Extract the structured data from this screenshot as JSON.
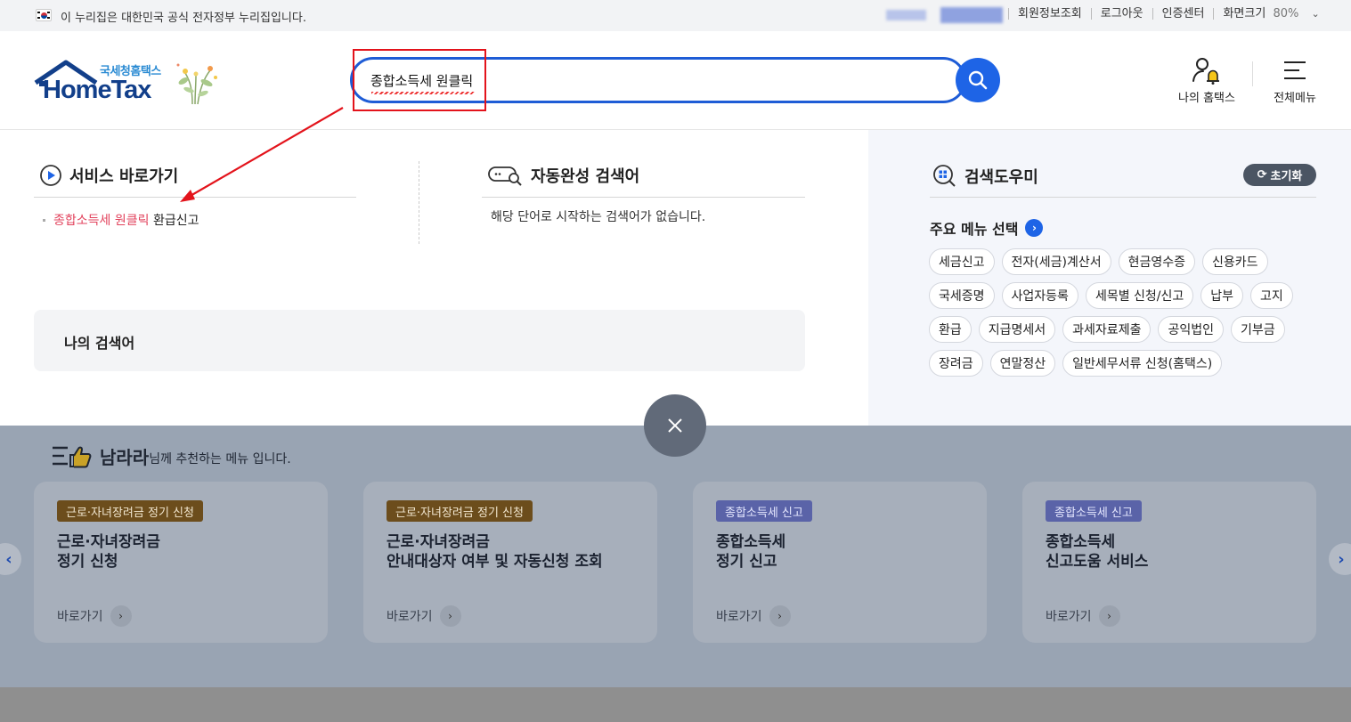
{
  "govbar": {
    "notice": "이 누리집은 대한민국 공식 전자정부 누리집입니다.",
    "links": [
      "회원정보조회",
      "로그아웃",
      "인증센터"
    ],
    "zoom_label": "화면크기",
    "zoom_value": "80%"
  },
  "header": {
    "logo_sub": "국세청홈택스",
    "logo_main": "HomeTax",
    "search_value": "종합소득세 원클릭",
    "mytax_label": "나의 홈택스",
    "allmenu_label": "전체메뉴"
  },
  "service_shortcut": {
    "title": "서비스 바로가기",
    "item_highlight": "종합소득세 원클릭",
    "item_rest": " 환급신고"
  },
  "autocomplete": {
    "title": "자동완성 검색어",
    "empty_message": "해당 단어로 시작하는 검색어가 없습니다."
  },
  "my_search": {
    "title": "나의 검색어"
  },
  "search_helper": {
    "title": "검색도우미",
    "reset_label": "초기화",
    "menu_select_label": "주요 메뉴 선택",
    "chips": [
      "세금신고",
      "전자(세금)계산서",
      "현금영수증",
      "신용카드",
      "국세증명",
      "사업자등록",
      "세목별 신청/신고",
      "납부",
      "고지",
      "환급",
      "지급명세서",
      "과세자료제출",
      "공익법인",
      "기부금",
      "장려금",
      "연말정산",
      "일반세무서류 신청(홈택스)"
    ]
  },
  "recommend": {
    "user_name": "남라라",
    "suffix": "님께 추천하는 메뉴 입니다.",
    "go_label": "바로가기",
    "cards": [
      {
        "tag": "근로·자녀장려금 정기 신청",
        "title": "근로·자녀장려금\n정기 신청"
      },
      {
        "tag": "근로·자녀장려금 정기 신청",
        "title": "근로·자녀장려금\n안내대상자 여부 및 자동신청 조회"
      },
      {
        "tag": "종합소득세 신고",
        "title": "종합소득세\n정기 신고"
      },
      {
        "tag": "종합소득세 신고",
        "title": "종합소득세\n신고도움 서비스"
      }
    ]
  },
  "colors": {
    "brand_blue": "#1e64e6",
    "highlight_red": "#e2425c",
    "annotation_red": "#e3131b"
  }
}
